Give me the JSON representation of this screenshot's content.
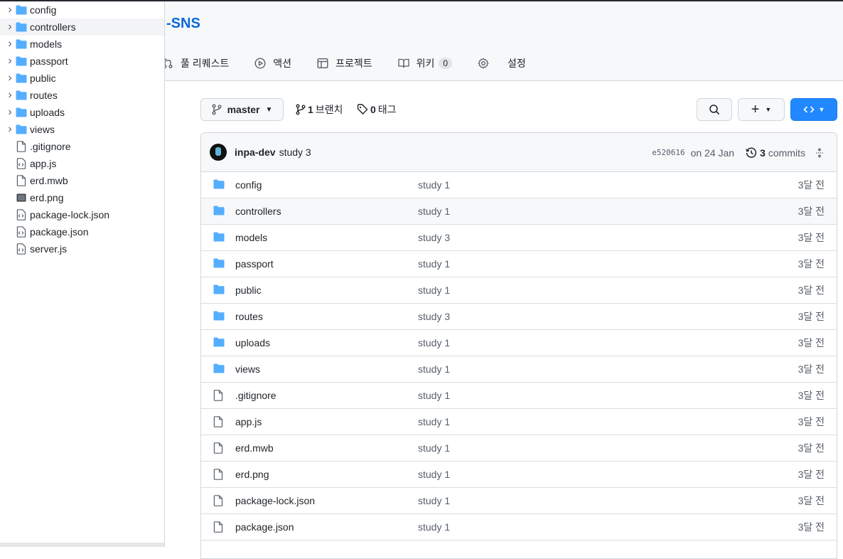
{
  "repo": {
    "title": "-SNS"
  },
  "nav": [
    {
      "label": "풀 리퀘스트",
      "icon": "pull-request-icon"
    },
    {
      "label": "액션",
      "icon": "play-icon"
    },
    {
      "label": "프로젝트",
      "icon": "table-icon"
    },
    {
      "label": "위키",
      "icon": "book-icon",
      "count": "0"
    },
    {
      "label": "설정",
      "icon": "gear-icon"
    }
  ],
  "toolbar": {
    "branch": "master",
    "branch_count": "1",
    "branch_label": "브랜치",
    "tag_count": "0",
    "tag_label": "태그"
  },
  "commit": {
    "author": "inpa-dev",
    "message": "study 3",
    "sha": "e520616",
    "date": "on 24 Jan",
    "count": "3",
    "count_label": "commits"
  },
  "tree": [
    {
      "name": "config",
      "type": "folder"
    },
    {
      "name": "controllers",
      "type": "folder",
      "selected": true
    },
    {
      "name": "models",
      "type": "folder"
    },
    {
      "name": "passport",
      "type": "folder"
    },
    {
      "name": "public",
      "type": "folder"
    },
    {
      "name": "routes",
      "type": "folder"
    },
    {
      "name": "uploads",
      "type": "folder"
    },
    {
      "name": "views",
      "type": "folder"
    },
    {
      "name": ".gitignore",
      "type": "file"
    },
    {
      "name": "app.js",
      "type": "script"
    },
    {
      "name": "erd.mwb",
      "type": "file"
    },
    {
      "name": "erd.png",
      "type": "image"
    },
    {
      "name": "package-lock.json",
      "type": "script"
    },
    {
      "name": "package.json",
      "type": "script"
    },
    {
      "name": "server.js",
      "type": "script"
    }
  ],
  "files": [
    {
      "name": "config",
      "type": "folder",
      "message": "study 1",
      "age": "3달 전"
    },
    {
      "name": "controllers",
      "type": "folder",
      "message": "study 1",
      "age": "3달 전"
    },
    {
      "name": "models",
      "type": "folder",
      "message": "study 3",
      "age": "3달 전"
    },
    {
      "name": "passport",
      "type": "folder",
      "message": "study 1",
      "age": "3달 전"
    },
    {
      "name": "public",
      "type": "folder",
      "message": "study 1",
      "age": "3달 전"
    },
    {
      "name": "routes",
      "type": "folder",
      "message": "study 3",
      "age": "3달 전"
    },
    {
      "name": "uploads",
      "type": "folder",
      "message": "study 1",
      "age": "3달 전"
    },
    {
      "name": "views",
      "type": "folder",
      "message": "study 1",
      "age": "3달 전"
    },
    {
      "name": ".gitignore",
      "type": "file",
      "message": "study 1",
      "age": "3달 전"
    },
    {
      "name": "app.js",
      "type": "file",
      "message": "study 1",
      "age": "3달 전"
    },
    {
      "name": "erd.mwb",
      "type": "file",
      "message": "study 1",
      "age": "3달 전"
    },
    {
      "name": "erd.png",
      "type": "file",
      "message": "study 1",
      "age": "3달 전"
    },
    {
      "name": "package-lock.json",
      "type": "file",
      "message": "study 1",
      "age": "3달 전"
    },
    {
      "name": "package.json",
      "type": "file",
      "message": "study 1",
      "age": "3달 전"
    }
  ],
  "colors": {
    "accent": "#0969da",
    "folder": "#54aeff",
    "code_button": "#2188ff"
  }
}
